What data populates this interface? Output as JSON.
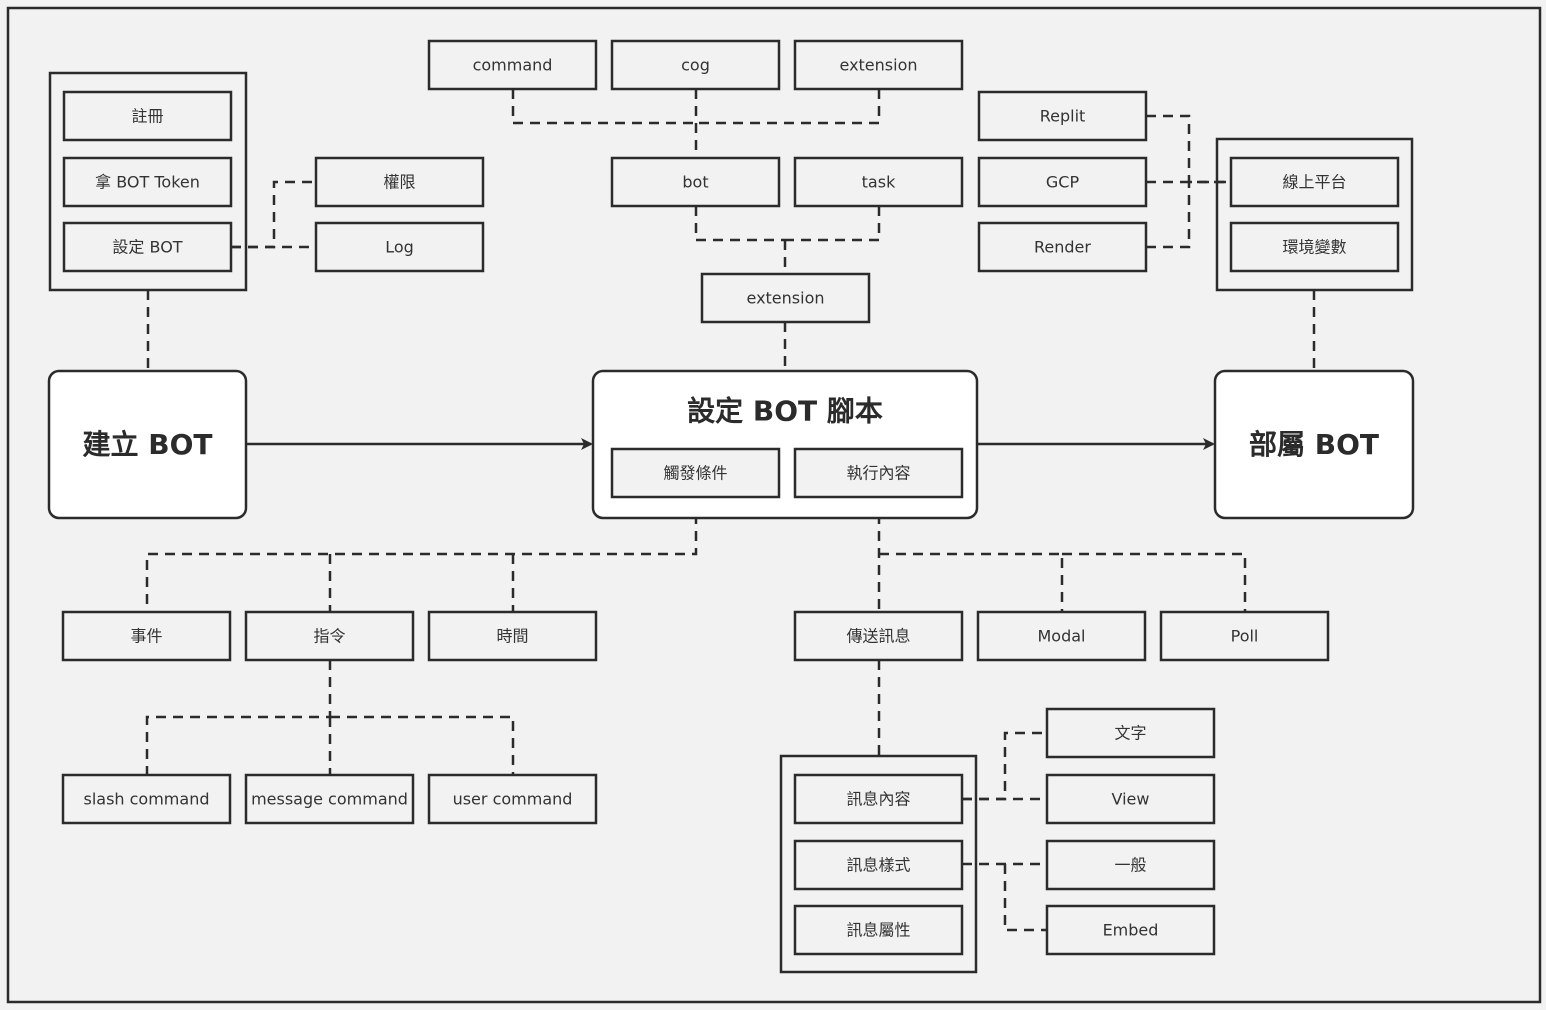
{
  "diagram": {
    "main": {
      "create_bot": "建立 BOT",
      "bot_script": "設定 BOT 腳本",
      "deploy_bot": "部屬 BOT"
    },
    "create_group": [
      "註冊",
      "拿 BOT Token",
      "設定 BOT"
    ],
    "setup_children": [
      "權限",
      "Log"
    ],
    "code_structure": {
      "top": [
        "command",
        "cog",
        "extension"
      ],
      "middle": [
        "bot",
        "task"
      ],
      "bottom": "extension"
    },
    "script_parts": [
      "觸發條件",
      "執行內容"
    ],
    "triggers": [
      "事件",
      "指令",
      "時間"
    ],
    "command_types": [
      "slash command",
      "message command",
      "user command"
    ],
    "actions": [
      "傳送訊息",
      "Modal",
      "Poll"
    ],
    "message_group": [
      "訊息內容",
      "訊息樣式",
      "訊息屬性"
    ],
    "message_content_types": [
      "文字",
      "View"
    ],
    "message_style_types": [
      "一般",
      "Embed"
    ],
    "platforms": [
      "Replit",
      "GCP",
      "Render"
    ],
    "deploy_group": [
      "線上平台",
      "環境變數"
    ]
  }
}
